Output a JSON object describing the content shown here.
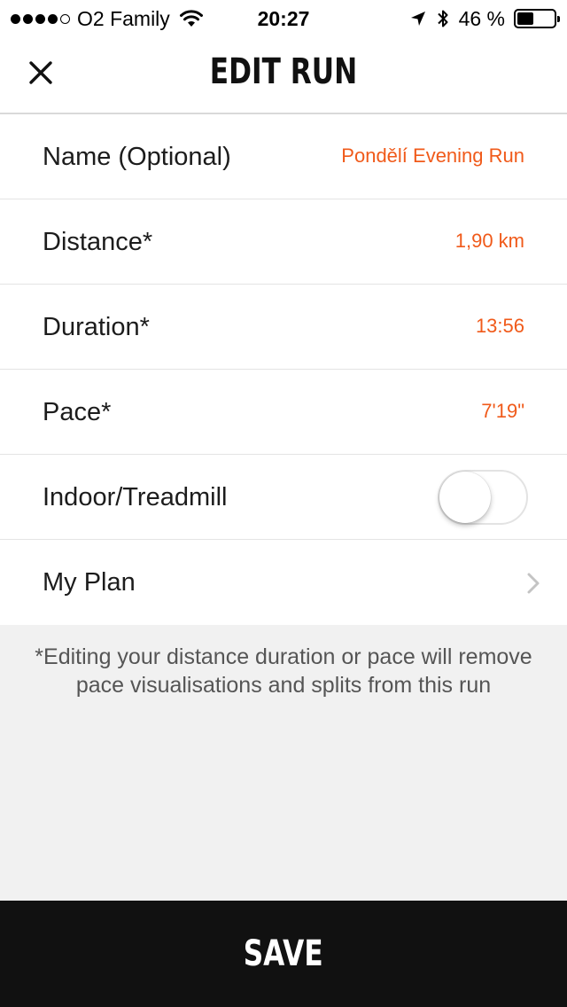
{
  "status_bar": {
    "carrier": "O2 Family",
    "time": "20:27",
    "battery_percent": "46 %",
    "battery_level": 0.46
  },
  "header": {
    "title": "EDIT RUN"
  },
  "rows": [
    {
      "label": "Name (Optional)",
      "value": "Pondělí Evening Run"
    },
    {
      "label": "Distance*",
      "value": "1,90 km"
    },
    {
      "label": "Duration*",
      "value": "13:56"
    },
    {
      "label": "Pace*",
      "value": "7'19\""
    },
    {
      "label": "Indoor/Treadmill",
      "toggle_on": false
    },
    {
      "label": "My Plan"
    }
  ],
  "note": "*Editing your distance duration or pace will remove pace visualisations and splits from this run",
  "save_label": "SAVE",
  "colors": {
    "accent": "#f05a1a",
    "save_bar": "#111111",
    "note_bg": "#f1f1f1"
  }
}
